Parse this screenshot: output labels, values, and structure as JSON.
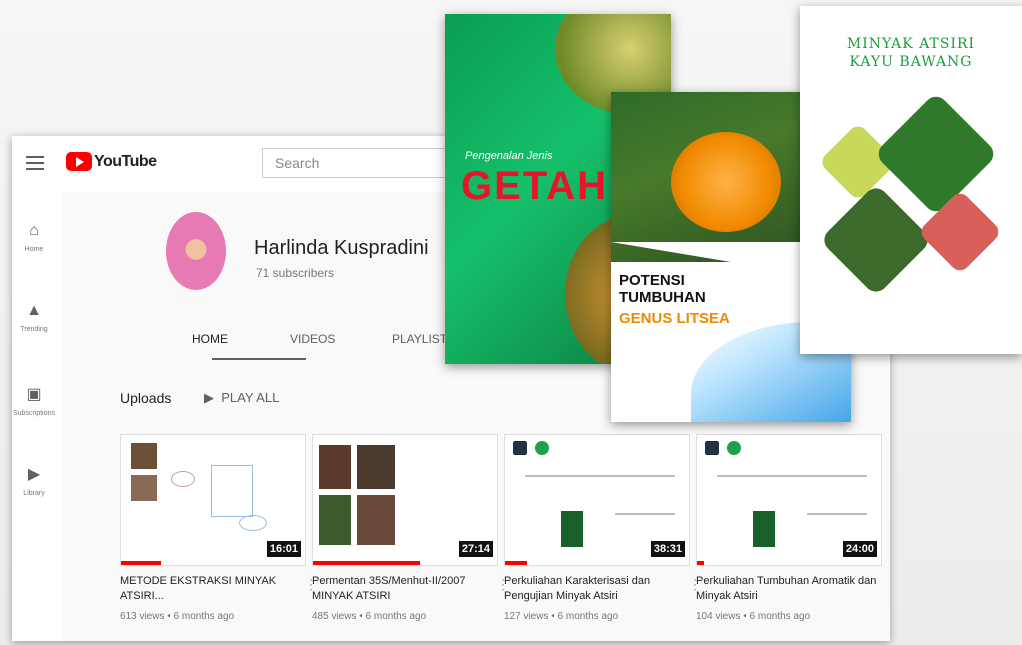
{
  "youtube": {
    "logo_text": "YouTube",
    "search_placeholder": "Search",
    "nav": [
      {
        "label": "Home",
        "icon": "home-icon"
      },
      {
        "label": "Trending",
        "icon": "trending-icon"
      },
      {
        "label": "Subscriptions",
        "icon": "subscriptions-icon"
      },
      {
        "label": "Library",
        "icon": "library-icon"
      }
    ],
    "channel": {
      "name": "Harlinda Kuspradini",
      "subscribers": "71 subscribers",
      "tabs": [
        "HOME",
        "VIDEOS",
        "PLAYLISTS"
      ]
    },
    "uploads": {
      "title": "Uploads",
      "play_all": "PLAY ALL",
      "videos": [
        {
          "title": "METODE EKSTRAKSI MINYAK ATSIRI...",
          "meta": "613 views • 6 months ago",
          "duration": "16:01",
          "progress": 0.22
        },
        {
          "title": "Permentan 35S/Menhut-II/2007 MINYAK ATSIRI",
          "meta": "485 views • 6 months ago",
          "duration": "27:14",
          "progress": 0.58
        },
        {
          "title": "Perkuliahan Karakterisasi dan Pengujian Minyak Atsiri",
          "meta": "127 views • 6 months ago",
          "duration": "38:31",
          "progress": 0.12
        },
        {
          "title": "Perkuliahan Tumbuhan Aromatik dan Minyak Atsiri",
          "meta": "104 views • 6 months ago",
          "duration": "24:00",
          "progress": 0.04
        }
      ]
    }
  },
  "books": [
    {
      "subtitle": "Pengenalan Jenis",
      "title": "GETAH"
    },
    {
      "title_line1": "POTENSI",
      "title_line2": "TUMBUHAN",
      "title_line3": "GENUS LITSEA"
    },
    {
      "title_line1": "MINYAK ATSIRI",
      "title_line2": "KAYU BAWANG"
    }
  ],
  "colors": {
    "accent": "#ff0000",
    "book_green": "#0a9d52",
    "litsea_orange": "#f08a00",
    "litsea_blue": "#1a8fe0"
  }
}
